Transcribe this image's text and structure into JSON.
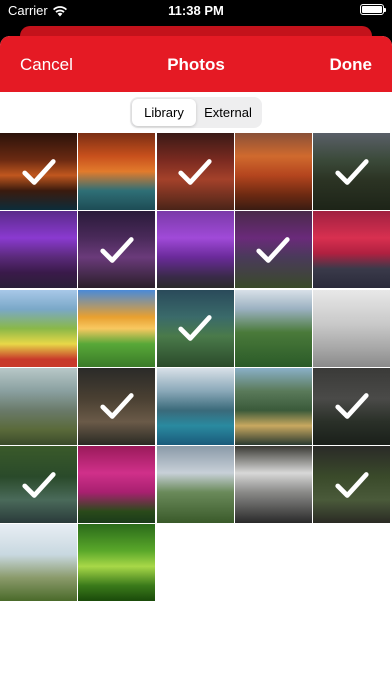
{
  "status": {
    "carrier": "Carrier",
    "time": "11:38 PM"
  },
  "nav": {
    "cancel": "Cancel",
    "title": "Photos",
    "done": "Done"
  },
  "segments": {
    "library": "Library",
    "external": "External",
    "selected": "Library"
  },
  "colors": {
    "accent": "#e51a24"
  },
  "photos": [
    {
      "selected": true,
      "bg": "linear-gradient(180deg,#2b120a 0%,#6b2a12 35%,#c0571e 55%,#3a1a0e 75%,#0c2c3a 100%)"
    },
    {
      "selected": false,
      "bg": "linear-gradient(180deg,#7a2e14 0%,#c8501c 30%,#e27b2c 50%,#2f6f76 75%,#1d4c55 100%)"
    },
    {
      "selected": true,
      "bg": "linear-gradient(180deg,#3a1a16 0%,#7a2a20 35%,#a4412a 60%,#4a2418 100%)"
    },
    {
      "selected": false,
      "bg": "linear-gradient(180deg,#8a5038 0%,#d06a2e 30%,#b4451e 55%,#6e2a12 80%,#3a1c12 100%)"
    },
    {
      "selected": true,
      "bg": "linear-gradient(180deg,#5a5f68 0%,#3b4a3a 35%,#2c3424 60%,#1d2418 100%)"
    },
    {
      "selected": false,
      "bg": "linear-gradient(180deg,#5a2a8a 0%,#8a3ad0 35%,#5a2a7a 60%,#3a1a4a 80%,#2a1f38 100%)"
    },
    {
      "selected": true,
      "bg": "linear-gradient(180deg,#2a1a3a 0%,#4a2a5a 35%,#6a3a7a 60%,#2a1f2a 100%)"
    },
    {
      "selected": false,
      "bg": "linear-gradient(180deg,#7a3aa8 0%,#a04ad8 35%,#6a2a9a 60%,#3a2a4a 85%,#2a2a2a 100%)"
    },
    {
      "selected": true,
      "bg": "linear-gradient(180deg,#4a2a4a 0%,#6a2a7a 35%,#4a3a5a 60%,#3a4a2a 100%)"
    },
    {
      "selected": false,
      "bg": "linear-gradient(180deg,#a02040 0%,#d83050 35%,#b02040 55%,#3a3a4a 75%,#2a2a3a 100%)"
    },
    {
      "selected": false,
      "bg": "linear-gradient(180deg,#a8c8e8 0%,#7aa8c8 25%,#8ab848 50%,#e8d848 70%,#c83a2a 90%)"
    },
    {
      "selected": false,
      "bg": "linear-gradient(180deg,#4a8ad8 0%,#e8a030 35%,#f8c860 50%,#58a838 70%,#3a7a28 100%)"
    },
    {
      "selected": true,
      "bg": "linear-gradient(180deg,#2a4a5a 0%,#3a6a6a 35%,#4a7a4a 60%,#2a4a2a 100%)"
    },
    {
      "selected": false,
      "bg": "linear-gradient(180deg,#d8e0e8 0%,#9ab0c0 25%,#4a7a3a 55%,#2a5a28 100%)"
    },
    {
      "selected": false,
      "bg": "linear-gradient(180deg,#e8e8e8 0%,#c8c8c8 45%,#a8a8a8 75%,#8a8a8a 100%)"
    },
    {
      "selected": false,
      "bg": "linear-gradient(180deg,#b8c8c8 0%,#8aa0a0 30%,#6a7a6a 55%,#5a6a3a 80%,#3a4a2a 100%)"
    },
    {
      "selected": true,
      "bg": "linear-gradient(180deg,#2a2a28 0%,#4a4032 40%,#6a5a48 70%,#2a2a24 100%)"
    },
    {
      "selected": false,
      "bg": "linear-gradient(180deg,#d8e0e8 0%,#8aa8b8 30%,#3a6a7a 55%,#2a8aa0 75%,#1a5a7a 100%)"
    },
    {
      "selected": false,
      "bg": "linear-gradient(180deg,#8ab0c8 0%,#5a7a5a 30%,#3a5a3a 55%,#c8a860 75%,#2a3a30 100%)"
    },
    {
      "selected": true,
      "bg": "linear-gradient(180deg,#3a3a38 0%,#4a4a48 40%,#2a3028 70%,#1a1f1a 100%)"
    },
    {
      "selected": true,
      "bg": "linear-gradient(180deg,#3a5a2a 0%,#2a4a2a 40%,#4a6a5a 70%,#2a3a3a 100%)"
    },
    {
      "selected": false,
      "bg": "linear-gradient(180deg,#9a1a5a 0%,#d0308a 35%,#a82070 60%,#2a4a1a 85%,#1a3a1a 100%)"
    },
    {
      "selected": false,
      "bg": "linear-gradient(180deg,#8a9aa8 0%,#c8d0d8 35%,#6a8a5a 60%,#3a5a2a 100%)"
    },
    {
      "selected": false,
      "bg": "linear-gradient(180deg,#3a3a34 0%,#d8d8d8 35%,#8a8a88 60%,#2a2a2a 100%)"
    },
    {
      "selected": true,
      "bg": "linear-gradient(180deg,#2a2a28 0%,#3a4a2a 40%,#4a5a3a 70%,#2a2a24 100%)"
    },
    {
      "selected": false,
      "bg": "linear-gradient(180deg,#e8eef4 0%,#c8d8e0 40%,#8a9a6a 70%,#4a6a2a 100%)"
    },
    {
      "selected": false,
      "bg": "linear-gradient(180deg,#2a6a1a 0%,#5aa82a 35%,#a8d848 55%,#3a7a1a 80%,#1a4a0a 100%)"
    }
  ]
}
